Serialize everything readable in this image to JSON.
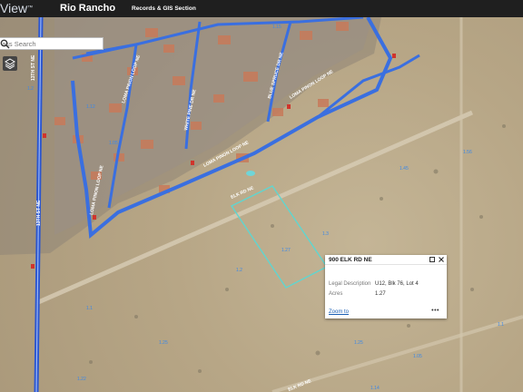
{
  "header": {
    "brand_prefix": "V",
    "brand_name": "iew",
    "brand_tm": "™",
    "city": "Rio Rancho",
    "section": "Records & GIS Section"
  },
  "search": {
    "placeholder": "ass Search"
  },
  "colors": {
    "road": "#3a6fe0",
    "road_edge": "#9cb8f5",
    "parcel": "#5fd6d0",
    "header_bg": "#1f1f1f",
    "hydrant": "#d0342c"
  },
  "map": {
    "street_labels": [
      "LOMA PINON LOOP NE",
      "WHITE PINE DR NE",
      "BLUE SPRUCE DR NE",
      "LOMA PINON LOOP NE",
      "LOMA PINON LOOP NE",
      "LOMA PINON LOOP NE",
      "ELK RD NE",
      "13TH ST NE",
      "13TH ST NE",
      "ELK RD NE"
    ]
  },
  "popup": {
    "title": "900 ELK RD NE",
    "fields": [
      {
        "label": "Legal Description",
        "value": "U12, Blk 76, Lot 4"
      },
      {
        "label": "Acres",
        "value": "1.27"
      }
    ],
    "zoom_link": "Zoom to",
    "more": "•••"
  }
}
